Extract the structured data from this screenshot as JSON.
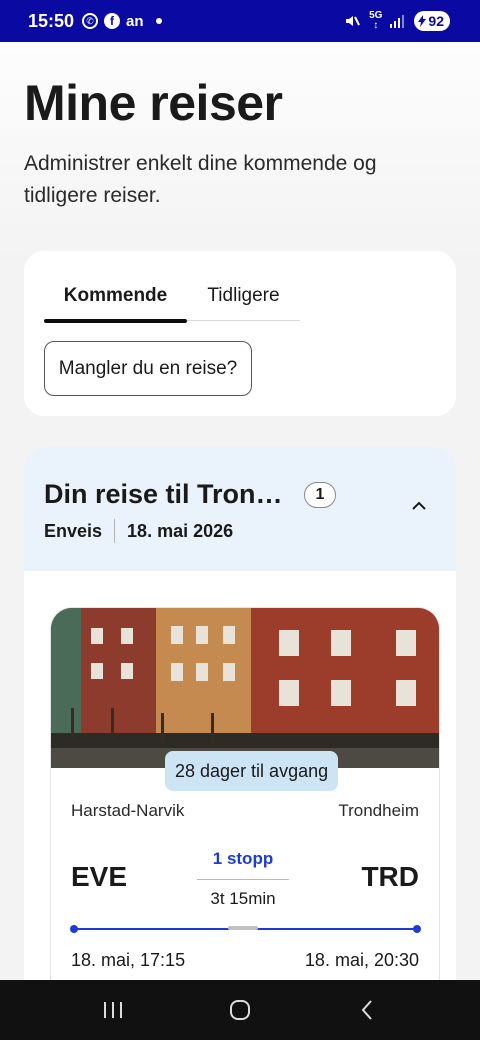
{
  "status_bar": {
    "time": "15:50",
    "carrier_text": "an",
    "battery": "92",
    "icons": [
      "whatsapp-icon",
      "facebook-icon",
      "mute-icon",
      "5g-icon",
      "signal-icon",
      "battery-icon"
    ]
  },
  "header": {
    "title": "Mine reiser",
    "subtitle": "Administrer enkelt dine kommende og tidligere reiser."
  },
  "tabs": {
    "items": [
      {
        "label": "Kommende",
        "active": true
      },
      {
        "label": "Tidligere",
        "active": false
      }
    ],
    "missing_button": "Mangler du en reise?"
  },
  "trip": {
    "title": "Din reise til Trondheim",
    "badge": "1",
    "type": "Enveis",
    "date": "18. mai 2026",
    "countdown": "28 dager til avgang",
    "origin_city": "Harstad-Narvik",
    "dest_city": "Trondheim",
    "origin_code": "EVE",
    "dest_code": "TRD",
    "stops": "1 stopp",
    "duration": "3t 15min",
    "departure": "18. mai, 17:15",
    "arrival": "18. mai, 20:30"
  },
  "colors": {
    "status_bar": "#0a0aa3",
    "accent": "#1e3bd6",
    "header_bg": "#eaf2fb",
    "countdown_bg": "#cde4f5"
  }
}
